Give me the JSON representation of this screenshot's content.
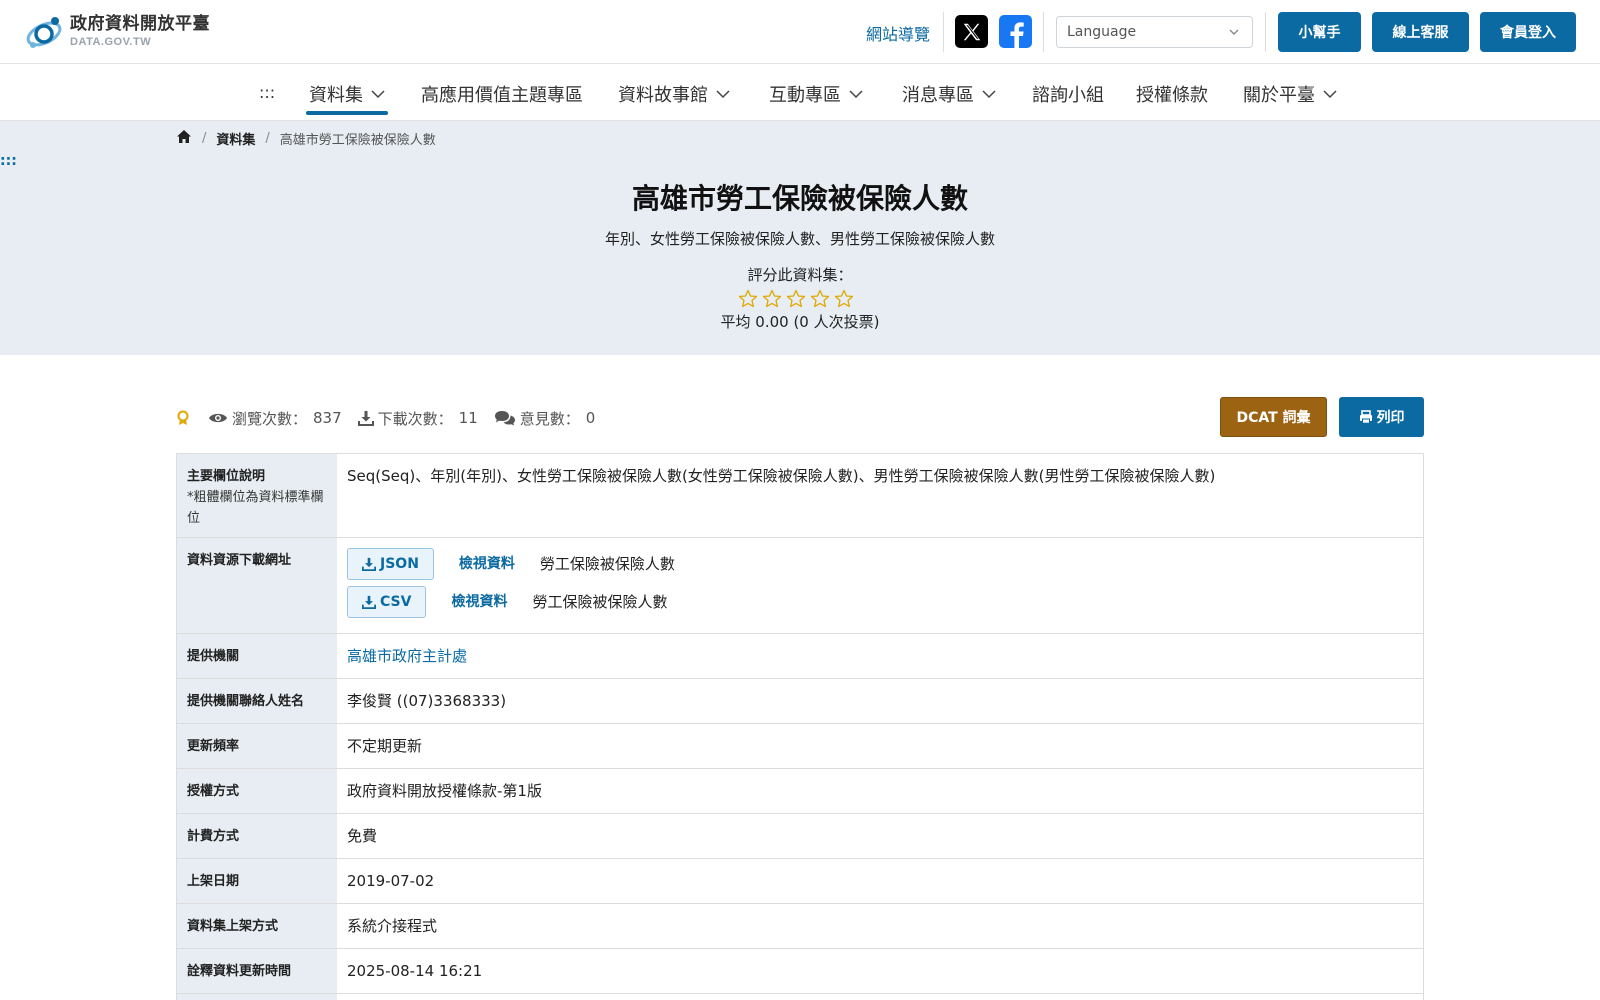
{
  "header": {
    "logo_title": "政府資料開放平臺",
    "logo_sub": "DATA.GOV.TW",
    "site_nav": "網站導覽",
    "language_placeholder": "Language",
    "helper_button": "小幫手",
    "support_button": "線上客服",
    "login_button": "會員登入"
  },
  "nav": {
    "anchor": ":::",
    "items": [
      {
        "label": "資料集",
        "has_dropdown": true,
        "active": true
      },
      {
        "label": "高應用價值主題專區",
        "has_dropdown": false
      },
      {
        "label": "資料故事館",
        "has_dropdown": true
      },
      {
        "label": "互動專區",
        "has_dropdown": true
      },
      {
        "label": "消息專區",
        "has_dropdown": true
      },
      {
        "label": "諮詢小組",
        "has_dropdown": false
      },
      {
        "label": "授權條款",
        "has_dropdown": false
      },
      {
        "label": "關於平臺",
        "has_dropdown": true
      }
    ]
  },
  "breadcrumb": {
    "level1": "資料集",
    "current": "高雄市勞工保險被保險人數"
  },
  "side_anchor": ":::",
  "dataset": {
    "title": "高雄市勞工保險被保險人數",
    "description": "年別、女性勞工保險被保險人數、男性勞工保險被保險人數",
    "rating_label": "評分此資料集：",
    "rating_stars": 0,
    "rating_max": 5,
    "rating_average": "平均 0.00 (0 人次投票)"
  },
  "stats": {
    "views_label": "瀏覽次數：",
    "views": "837",
    "downloads_label": "下載次數：",
    "downloads": "11",
    "comments_label": "意見數：",
    "comments": "0"
  },
  "actions": {
    "dcat": "DCAT 詞彙",
    "print": "列印"
  },
  "details": {
    "fields_label": "主要欄位說明",
    "fields_note": "*粗體欄位為資料標準欄位",
    "fields_value": "Seq(Seq)、年別(年別)、女性勞工保險被保險人數(女性勞工保險被保險人數)、男性勞工保險被保險人數(男性勞工保險被保險人數)",
    "resources_label": "資料資源下載網址",
    "resources": [
      {
        "format": "JSON",
        "view": "檢視資料",
        "name": "勞工保險被保險人數"
      },
      {
        "format": "CSV",
        "view": "檢視資料",
        "name": "勞工保險被保險人數"
      }
    ],
    "provider_label": "提供機關",
    "provider_value": "高雄市政府主計處",
    "contact_label": "提供機關聯絡人姓名",
    "contact_value": "李俊賢 ((07)3368333)",
    "frequency_label": "更新頻率",
    "frequency_value": "不定期更新",
    "license_label": "授權方式",
    "license_value": "政府資料開放授權條款-第1版",
    "fee_label": "計費方式",
    "fee_value": "免費",
    "onshelf_label": "上架日期",
    "onshelf_value": "2019-07-02",
    "method_label": "資料集上架方式",
    "method_value": "系統介接程式",
    "meta_update_label": "詮釋資料更新時間",
    "meta_update_value": "2025-08-14 16:21"
  },
  "colors": {
    "primary": "#0b6aa2",
    "dcat": "#9c6313",
    "hero_bg": "#e7edf2",
    "star": "#e0a800"
  }
}
